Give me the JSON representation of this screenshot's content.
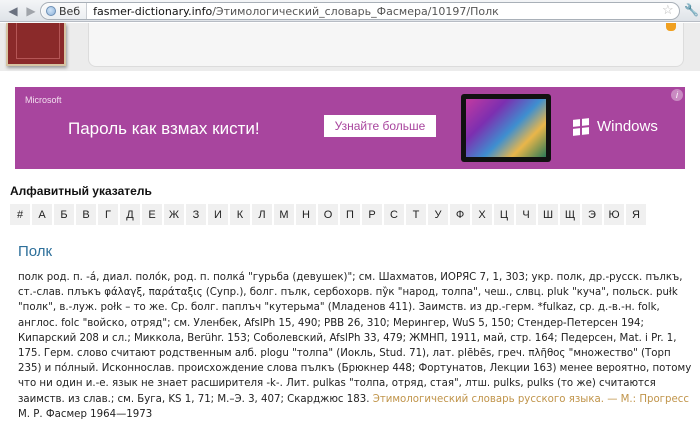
{
  "browser": {
    "tab_label": "Веб",
    "url_host": "fasmer-dictionary.info",
    "url_path": "/Этимологический_словарь_Фасмера/10197/Полк"
  },
  "ad": {
    "brand": "Microsoft",
    "headline": "Пароль как взмах кисти!",
    "cta": "Узнайте больше",
    "product": "Windows",
    "info": "i"
  },
  "alphabet": {
    "title": "Алфавитный указатель",
    "letters": [
      "#",
      "А",
      "Б",
      "В",
      "Г",
      "Д",
      "Е",
      "Ж",
      "З",
      "И",
      "К",
      "Л",
      "М",
      "Н",
      "О",
      "П",
      "Р",
      "С",
      "Т",
      "У",
      "Ф",
      "Х",
      "Ц",
      "Ч",
      "Ш",
      "Щ",
      "Э",
      "Ю",
      "Я"
    ]
  },
  "entry": {
    "title": "Полк",
    "lines": [
      "полк род. п. -á, диал. поло́к, род. п. полка́ \"гурьба (девушек)\"; см. Шахматов, ИОРЯС 7, 1, 303; укр. полк, др.-русск. пълкъ,",
      "ст.-слав. плъкъ φάλαγξ, παράταξις (Супр.), болг. пълк, сербохорв. пу̏к \"народ, толпа\", чеш., слвц. pluk \"куча\", польск. pułk",
      "\"полк\", в.-луж. połk – то же. Ср. болг. паплъч \"кутерьма\" (Младенов 411). Заимств. из др.-герм. *fulkaz, ср. д.-в.-н. folk,",
      "англос. folc \"войско, отряд\"; см. Уленбек, AfslPh 15, 490; РВВ 26, 310; Мерингер, WuS 5, 150; Стендер-Петерсен 194;",
      "Кипарский 208 и сл.; Миккола, Berühr. 153; Соболевский, AfslPh 33, 479; ЖМНП, 1911, май, стр. 164; Педерсен, Mat. i Pr. 1,",
      "175. Герм. слово считают родственным алб. plogu \"толпа\" (Иокль, Stud. 71), лат. plēbēs, греч. πλῆθος \"множество\" (Торп",
      "235) и по́лный. Исконнослав. происхождение слова пълкъ (Брюкнер 448; Фортунатов, Лекции 163) менее вероятно, потому",
      "что ни один и.-е. язык не знает расширителя -k-. Лит. pulkas \"толпа, отряд, стая\", лтш. pulks, pulks (то же) считаются",
      "заимств. из слав.; см. Буга, KS 1, 71; М.–Э. 3, 407; Скарджюс 183."
    ],
    "source": "Этимологический словарь русского языка. — М.: Прогресс",
    "author_line": "М. Р. Фасмер 1964—1973"
  },
  "colors": {
    "ad_background": "#a8459e",
    "entry_title": "#2d6f9a",
    "source_link": "#c0944a"
  }
}
